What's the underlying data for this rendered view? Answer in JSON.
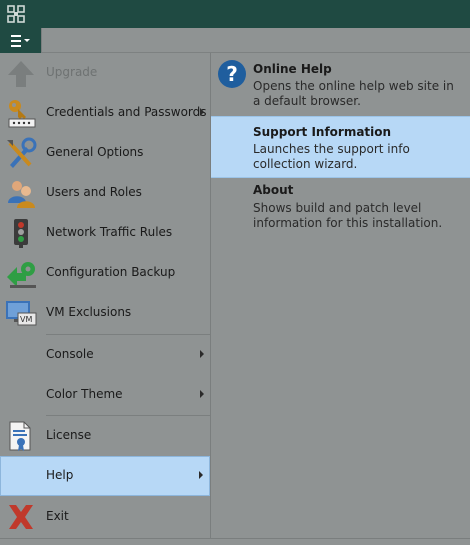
{
  "menu": {
    "items": [
      {
        "label": "Upgrade",
        "icon": "upgrade-arrow-icon",
        "disabled": true
      },
      {
        "label": "Credentials and Passwords",
        "icon": "key-password-icon",
        "submenu": true
      },
      {
        "label": "General Options",
        "icon": "tools-icon"
      },
      {
        "label": "Users and Roles",
        "icon": "users-icon"
      },
      {
        "label": "Network Traffic Rules",
        "icon": "traffic-light-icon"
      },
      {
        "label": "Configuration Backup",
        "icon": "config-backup-icon"
      },
      {
        "label": "VM Exclusions",
        "icon": "vm-exclusions-icon"
      },
      {
        "label": "Console",
        "submenu": true
      },
      {
        "label": "Color Theme",
        "submenu": true
      },
      {
        "label": "License",
        "icon": "license-certificate-icon"
      },
      {
        "label": "Help",
        "submenu": true,
        "selected": true
      },
      {
        "label": "Exit",
        "icon": "exit-x-icon"
      }
    ]
  },
  "help": {
    "items": [
      {
        "title": "Online Help",
        "description": "Opens the online help web site in a default browser."
      },
      {
        "title": "Support Information",
        "description": "Launches the support info collection wizard.",
        "selected": true
      },
      {
        "title": "About",
        "description": "Shows build and patch level information for this installation."
      }
    ]
  },
  "colors": {
    "titlebar": "#1f4a42",
    "selected_bg": "#b7d8f6",
    "panel_bg": "#8f9393"
  }
}
